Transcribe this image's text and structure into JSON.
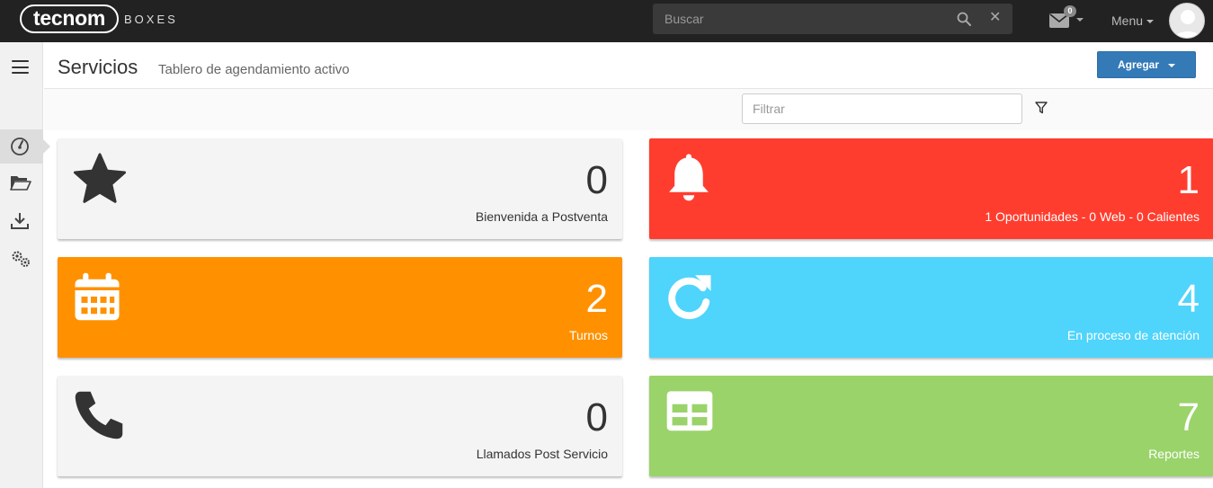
{
  "header": {
    "logo": "tecnom",
    "product": "BOXES",
    "search_placeholder": "Buscar",
    "mail_badge": "0",
    "menu_label": "Menu"
  },
  "sidebar": {
    "items": [
      {
        "icon": "dashboard-icon",
        "active": true
      },
      {
        "icon": "folder-open-icon",
        "active": false
      },
      {
        "icon": "download-icon",
        "active": false
      },
      {
        "icon": "settings-icon",
        "active": false
      }
    ]
  },
  "page": {
    "title": "Servicios",
    "subtitle": "Tablero de agendamiento activo",
    "add_button": "Agregar",
    "filter_placeholder": "Filtrar"
  },
  "cards": [
    {
      "count": "0",
      "label": "Bienvenida a Postventa",
      "icon": "star-icon",
      "color": "#f4f4f4"
    },
    {
      "count": "1",
      "label": "1 Oportunidades - 0 Web - 0 Calientes",
      "icon": "bell-icon",
      "color": "#ff3d2e"
    },
    {
      "count": "2",
      "label": "Turnos",
      "icon": "calendar-icon",
      "color": "#ff9100"
    },
    {
      "count": "4",
      "label": "En proceso de atención",
      "icon": "refresh-icon",
      "color": "#4fd4fc"
    },
    {
      "count": "0",
      "label": "Llamados Post Servicio",
      "icon": "phone-icon",
      "color": "#f4f4f4"
    },
    {
      "count": "7",
      "label": "Reportes",
      "icon": "table-icon",
      "color": "#9ad36a"
    }
  ]
}
